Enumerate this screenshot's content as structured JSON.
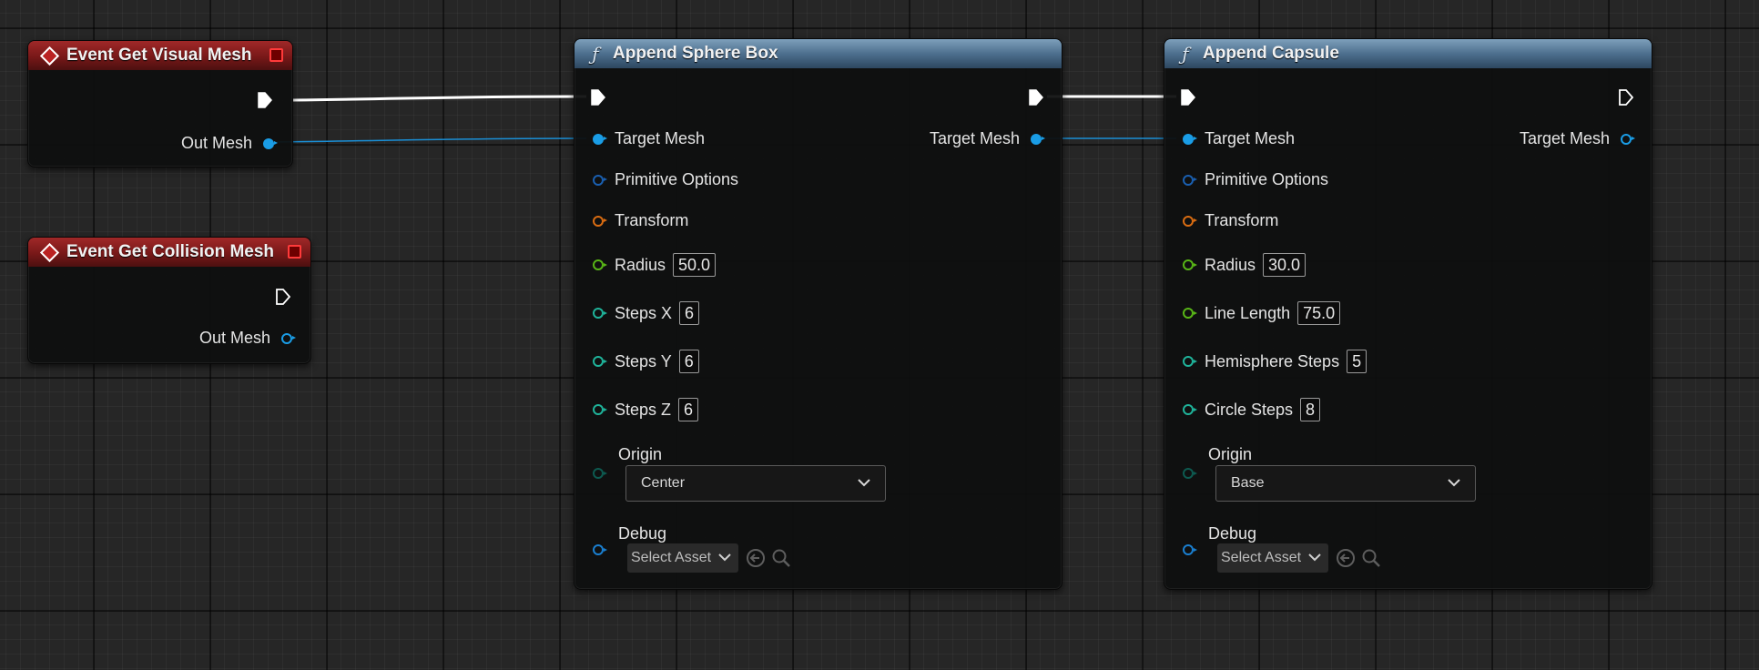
{
  "nodes": {
    "visual_event": {
      "title": "Event Get Visual Mesh",
      "out_mesh": "Out Mesh"
    },
    "collision_event": {
      "title": "Event Get Collision Mesh",
      "out_mesh": "Out Mesh"
    },
    "sphere_box": {
      "title": "Append Sphere Box",
      "pins": {
        "target_mesh": "Target Mesh",
        "out_target_mesh": "Target Mesh",
        "primitive_options": "Primitive Options",
        "transform": "Transform",
        "radius": "Radius",
        "steps_x": "Steps X",
        "steps_y": "Steps Y",
        "steps_z": "Steps Z",
        "origin": "Origin",
        "debug": "Debug"
      },
      "values": {
        "radius": "50.0",
        "steps_x": "6",
        "steps_y": "6",
        "steps_z": "6",
        "origin": "Center",
        "debug_asset": "Select Asset"
      }
    },
    "capsule": {
      "title": "Append Capsule",
      "pins": {
        "target_mesh": "Target Mesh",
        "out_target_mesh": "Target Mesh",
        "primitive_options": "Primitive Options",
        "transform": "Transform",
        "radius": "Radius",
        "line_length": "Line Length",
        "hemisphere_steps": "Hemisphere Steps",
        "circle_steps": "Circle Steps",
        "origin": "Origin",
        "debug": "Debug"
      },
      "values": {
        "radius": "30.0",
        "line_length": "75.0",
        "hemisphere_steps": "5",
        "circle_steps": "8",
        "origin": "Base",
        "debug_asset": "Select Asset"
      }
    }
  },
  "colors": {
    "mesh_pin": "#1a9de6",
    "options_pin": "#1a5fb0",
    "transform_pin": "#d96c12",
    "float_pin": "#58b517",
    "int_pin": "#1fb39a",
    "enum_pin": "#0d5a50",
    "event_header": "#8a1f1f",
    "function_header": "#4d6f8e",
    "exec_wire": "#ffffff",
    "mesh_wire": "#1a8fd6"
  }
}
